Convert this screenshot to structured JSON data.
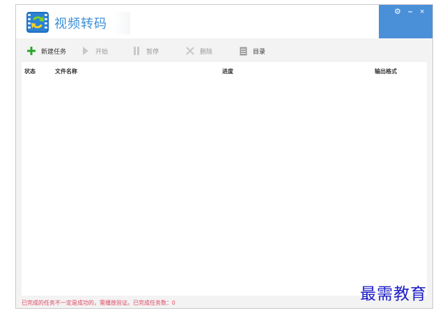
{
  "app": {
    "title": "视频转码"
  },
  "window_controls": {
    "settings": "⚙",
    "minimize": "–",
    "close": "×"
  },
  "toolbar": {
    "new_task": "新建任务",
    "start": "开始",
    "pause": "暂停",
    "delete": "删除",
    "folder": "目录"
  },
  "table": {
    "columns": {
      "status": "状态",
      "filename": "文件名称",
      "progress": "进度",
      "format": "输出格式"
    }
  },
  "footer": {
    "note": "已完成的任务不一定是成功的，需播放验证。已完成任务数：0"
  },
  "watermark": "最需教育",
  "colors": {
    "accent": "#4a90d9",
    "title": "#3a8fd6",
    "footer_text": "#e0455f",
    "add_icon": "#2aa52a"
  }
}
